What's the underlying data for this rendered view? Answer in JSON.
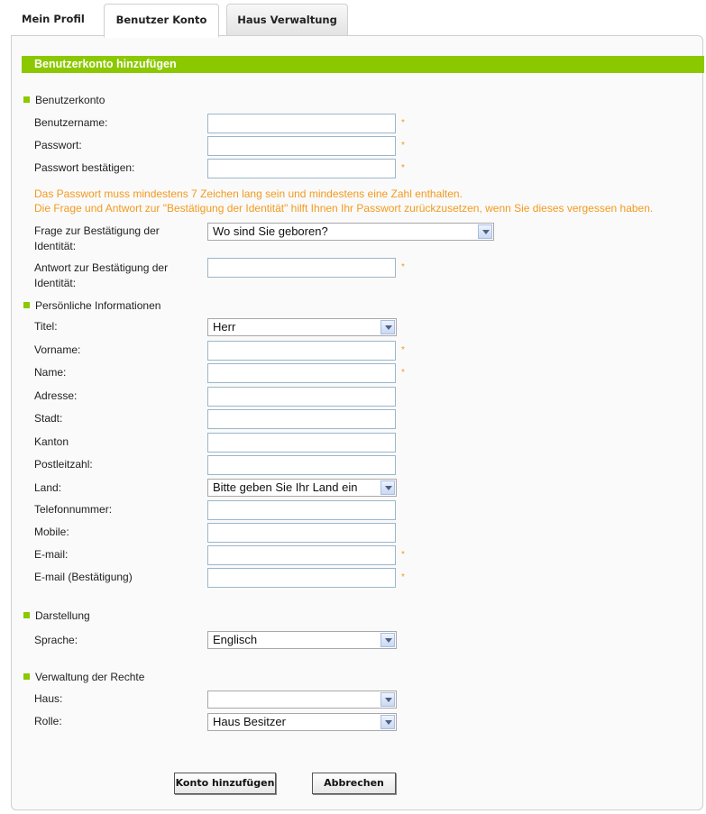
{
  "tabs": [
    {
      "label": "Mein Profil"
    },
    {
      "label": "Benutzer Konto"
    },
    {
      "label": "Haus Verwaltung"
    }
  ],
  "header": {
    "title": "Benutzerkonto hinzufügen"
  },
  "sections": {
    "account": "Benutzerkonto",
    "personal": "Persönliche Informationen",
    "display": "Darstellung",
    "rights": "Verwaltung der Rechte"
  },
  "fields": {
    "username": "Benutzername:",
    "password": "Passwort:",
    "password_confirm": "Passwort bestätigen:",
    "question": "Frage zur Bestätigung der Identität:",
    "answer": "Antwort zur Bestätigung der Identität:",
    "title": "Titel:",
    "firstname": "Vorname:",
    "name": "Name:",
    "address": "Adresse:",
    "city": "Stadt:",
    "canton": "Kanton",
    "zip": "Postleitzahl:",
    "country": "Land:",
    "phone": "Telefonnummer:",
    "mobile": "Mobile:",
    "email": "E-mail:",
    "email_confirm": "E-mail (Bestätigung)",
    "language": "Sprache:",
    "house": "Haus:",
    "role": "Rolle:"
  },
  "notes": {
    "line1": "Das Passwort muss mindestens 7 Zeichen lang sein und mindestens eine Zahl enthalten.",
    "line2": "Die Frage und Antwort zur \"Bestätigung der Identität\" hilft Ihnen Ihr Passwort zurückzusetzen, wenn Sie dieses vergessen haben."
  },
  "selects": {
    "question": "Wo sind Sie geboren?",
    "title": "Herr",
    "country": "Bitte geben Sie Ihr Land ein",
    "language": "Englisch",
    "house": "",
    "role": "Haus Besitzer"
  },
  "required_mark": "*",
  "buttons": {
    "submit": "Konto hinzufügen",
    "cancel": "Abbrechen"
  },
  "colors": {
    "accent": "#8cc800",
    "note": "#f39a1e"
  }
}
